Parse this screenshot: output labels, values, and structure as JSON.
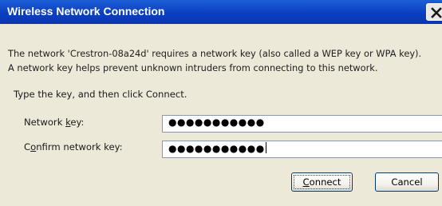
{
  "window": {
    "title": "Wireless Network Connection"
  },
  "message": {
    "line1": "The network 'Crestron-08a24d' requires a network key (also called a WEP key or WPA key).",
    "line2": "A network key helps prevent unknown intruders from connecting to this network."
  },
  "instruction": "Type the key, and then click Connect.",
  "fields": {
    "network_key": {
      "label_pre": "Network ",
      "label_access_key": "k",
      "label_post": "ey:",
      "value": "●●●●●●●●●●●"
    },
    "confirm_key": {
      "label_pre": "C",
      "label_access_key": "o",
      "label_post": "nfirm network key:",
      "value": "●●●●●●●●●●●"
    }
  },
  "buttons": {
    "connect_access_key": "C",
    "connect_rest": "onnect",
    "cancel": "Cancel"
  },
  "icons": {
    "close": "close-icon"
  }
}
